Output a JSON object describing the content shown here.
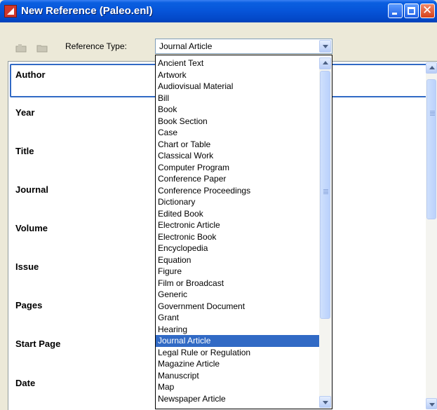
{
  "window": {
    "title": "New Reference (Paleo.enl)"
  },
  "toolbar": {
    "reference_type_label": "Reference Type:",
    "reference_type_value": "Journal Article"
  },
  "fields": [
    "Author",
    "Year",
    "Title",
    "Journal",
    "Volume",
    "Issue",
    "Pages",
    "Start Page",
    "Date"
  ],
  "dropdown": {
    "items": [
      "Ancient Text",
      "Artwork",
      "Audiovisual Material",
      "Bill",
      "Book",
      "Book Section",
      "Case",
      "Chart or Table",
      "Classical Work",
      "Computer Program",
      "Conference Paper",
      "Conference Proceedings",
      "Dictionary",
      "Edited Book",
      "Electronic Article",
      "Electronic Book",
      "Encyclopedia",
      "Equation",
      "Figure",
      "Film or Broadcast",
      "Generic",
      "Government Document",
      "Grant",
      "Hearing",
      "Journal Article",
      "Legal Rule or Regulation",
      "Magazine Article",
      "Manuscript",
      "Map",
      "Newspaper Article"
    ],
    "selected": "Journal Article"
  }
}
